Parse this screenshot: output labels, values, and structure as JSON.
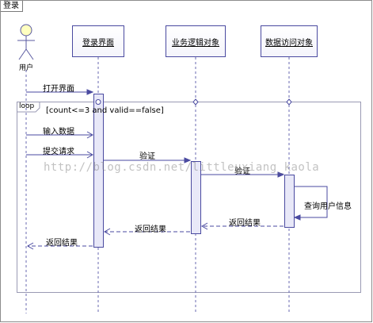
{
  "frame": {
    "title": "登录"
  },
  "actor": {
    "label": "用户"
  },
  "lifelines": [
    {
      "id": "ui",
      "label": "登录界面"
    },
    {
      "id": "biz",
      "label": "业务逻辑对象"
    },
    {
      "id": "data",
      "label": "数据访问对象"
    }
  ],
  "loop": {
    "keyword": "loop",
    "guard": "[count<=3 and valid==false]"
  },
  "messages": {
    "open_ui": "打开界面",
    "input_data": "输入数据",
    "submit": "提交请求",
    "verify_1": "验证",
    "verify_2": "验证",
    "query_user": "查询用户信息",
    "return_1": "返回结果",
    "return_2": "返回结果",
    "return_3": "返回结果"
  },
  "watermark": "http://blog.csdn.net/littleuxiang_kaola",
  "colors": {
    "line": "#4a4aa0",
    "activation_fill": "#e8e8f8",
    "frame": "#8c8c8c"
  }
}
